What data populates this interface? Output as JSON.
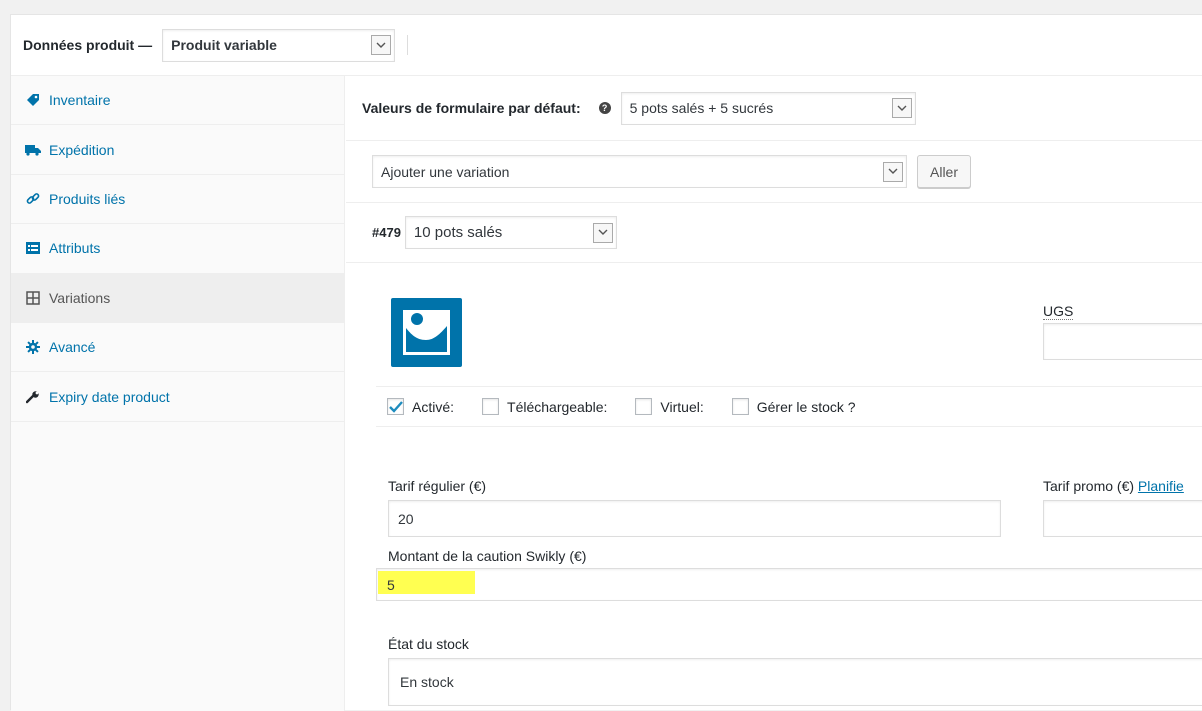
{
  "header": {
    "label": "Données produit —",
    "product_type": "Produit variable"
  },
  "tabs": [
    {
      "label": "Inventaire",
      "icon": "tag-icon",
      "active": false
    },
    {
      "label": "Expédition",
      "icon": "truck-icon",
      "active": false
    },
    {
      "label": "Produits liés",
      "icon": "link-icon",
      "active": false
    },
    {
      "label": "Attributs",
      "icon": "list-icon",
      "active": false
    },
    {
      "label": "Variations",
      "icon": "grid-icon",
      "active": true
    },
    {
      "label": "Avancé",
      "icon": "gear-icon",
      "active": false
    },
    {
      "label": "Expiry date product",
      "icon": "wrench-icon",
      "active": false
    }
  ],
  "defaults_row": {
    "label": "Valeurs de formulaire par défaut:",
    "value": "5 pots salés + 5 sucrés"
  },
  "add_variation": {
    "select_value": "Ajouter une variation",
    "go_label": "Aller"
  },
  "variation": {
    "id": "#479",
    "name": "10 pots salés",
    "ugs_label": "UGS",
    "ugs_value": "",
    "checkboxes": [
      {
        "label": "Activé:",
        "checked": true
      },
      {
        "label": "Téléchargeable:",
        "checked": false
      },
      {
        "label": "Virtuel:",
        "checked": false
      },
      {
        "label": "Gérer le stock ?",
        "checked": false
      }
    ],
    "regular_price_label": "Tarif régulier (€)",
    "regular_price_value": "20",
    "promo_label": "Tarif promo (€)",
    "promo_link": "Planifie",
    "promo_value": "",
    "deposit_label": "Montant de la caution Swikly (€)",
    "deposit_value": "5",
    "stock_status_label": "État du stock",
    "stock_status_value": "En stock"
  },
  "colors": {
    "link": "#0073aa",
    "highlight": "#ffff33"
  }
}
